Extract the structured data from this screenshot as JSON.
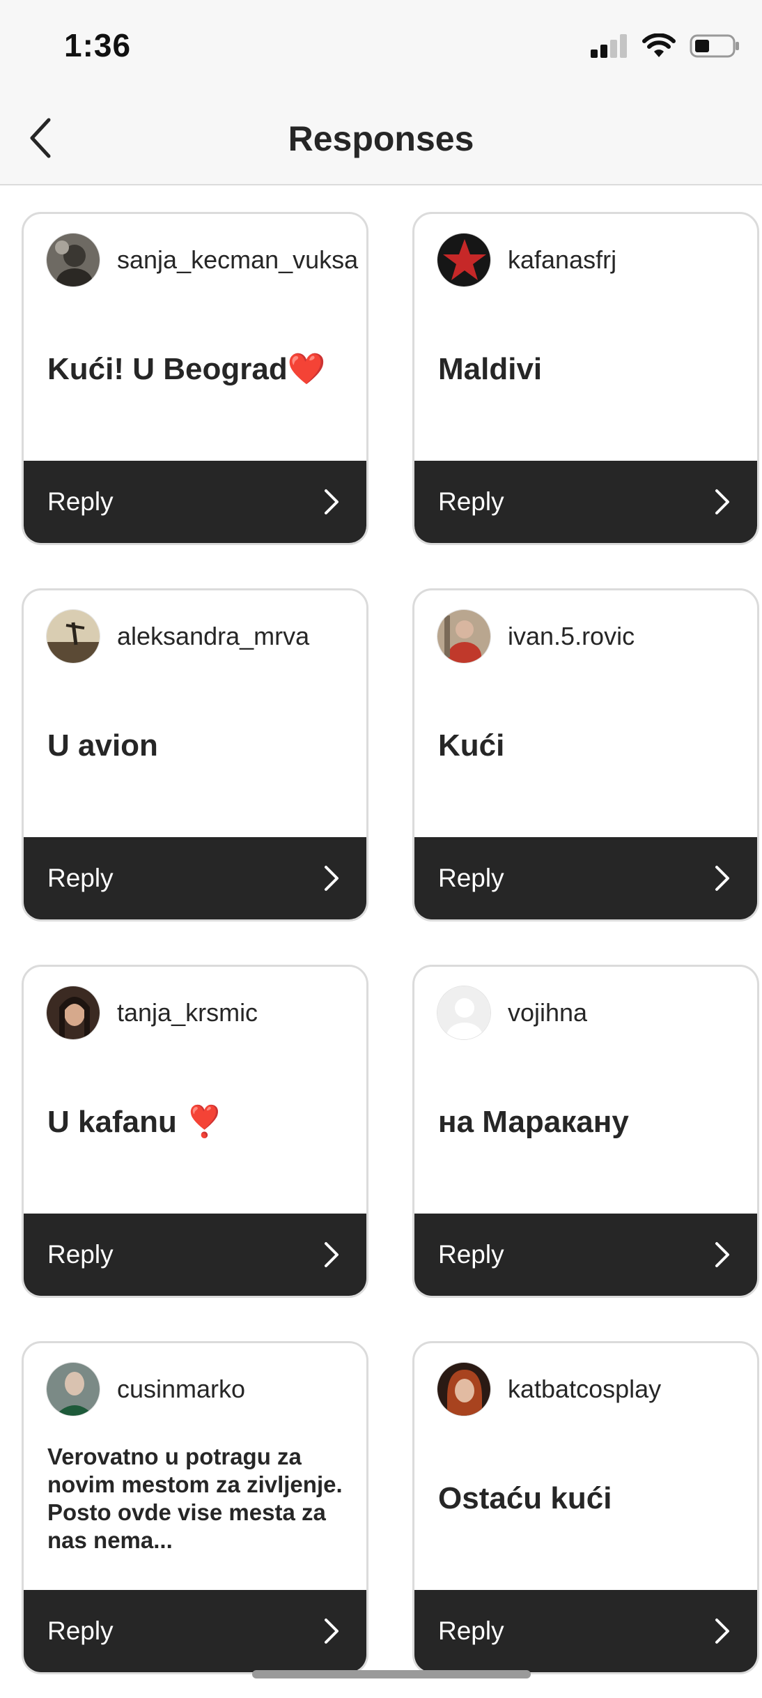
{
  "status_bar": {
    "time": "1:36",
    "icons": [
      "cellular-signal-icon",
      "wifi-icon",
      "battery-icon"
    ]
  },
  "nav": {
    "title": "Responses",
    "back_icon": "chevron-left-icon"
  },
  "reply_label": "Reply",
  "responses": [
    {
      "username": "sanja_kecman_vuksa",
      "text": "Kući! U Beograd❤️"
    },
    {
      "username": "kafanasfrj",
      "text": "Maldivi"
    },
    {
      "username": "aleksandra_mrva",
      "text": "U avion"
    },
    {
      "username": "ivan.5.rovic",
      "text": "Kući"
    },
    {
      "username": "tanja_krsmic",
      "text": "U kafanu ❣️"
    },
    {
      "username": "vojihna",
      "text": "на Маракану"
    },
    {
      "username": "cusinmarko",
      "text": "Verovatno u potragu za novim mestom za zivljenje. Posto ovde vise mesta za nas nema..."
    },
    {
      "username": "katbatcosplay",
      "text": "Ostaću kući"
    }
  ],
  "colors": {
    "reply_bar": "#262626",
    "card_border": "#dbdbdb",
    "background": "#ffffff"
  }
}
